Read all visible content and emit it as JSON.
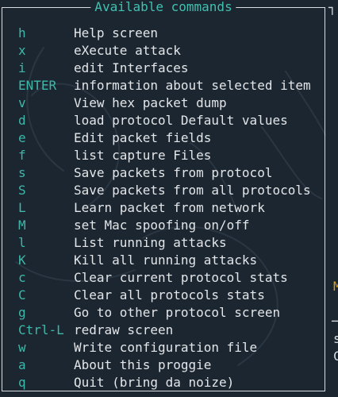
{
  "dialog": {
    "title": "Available commands"
  },
  "commands": [
    {
      "key": "h",
      "description": "Help screen"
    },
    {
      "key": "x",
      "description": "eXecute attack"
    },
    {
      "key": "i",
      "description": "edit Interfaces"
    },
    {
      "key": "ENTER",
      "description": "information about selected item"
    },
    {
      "key": "v",
      "description": "View hex packet dump"
    },
    {
      "key": "d",
      "description": "load protocol Default values"
    },
    {
      "key": "e",
      "description": "Edit packet fields"
    },
    {
      "key": "f",
      "description": "list capture Files"
    },
    {
      "key": "s",
      "description": "Save packets from protocol"
    },
    {
      "key": "S",
      "description": "Save packets from all protocols"
    },
    {
      "key": "L",
      "description": "Learn packet from network"
    },
    {
      "key": "M",
      "description": "set Mac spoofing on/off"
    },
    {
      "key": "l",
      "description": "List running attacks"
    },
    {
      "key": "K",
      "description": "Kill all running attacks"
    },
    {
      "key": "c",
      "description": "Clear current protocol stats"
    },
    {
      "key": "C",
      "description": "Clear all protocols stats"
    },
    {
      "key": "g",
      "description": "Go to other protocol screen"
    },
    {
      "key": "Ctrl-L",
      "description": "redraw screen"
    },
    {
      "key": "w",
      "description": "Write configuration file"
    },
    {
      "key": "a",
      "description": "About this proggie"
    },
    {
      "key": "q",
      "description": "Quit (bring da noize)"
    }
  ],
  "background_edge": {
    "top_corner": "┐",
    "marker": "M",
    "rule": "─",
    "char_s": "s",
    "char_c": "C"
  },
  "colors": {
    "background": "#1c2630",
    "border": "#d9dde1",
    "title": "#40c0b0",
    "key": "#3db8a8",
    "description": "#e3e6e9",
    "marker": "#d9a019"
  }
}
